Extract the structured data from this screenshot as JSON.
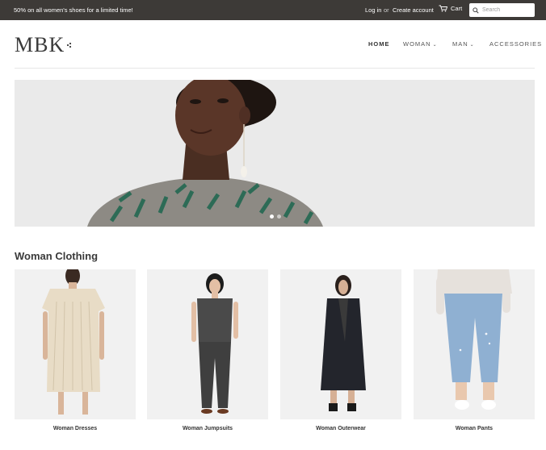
{
  "announcement": {
    "text": "50% on all women's shoes for a limited time!"
  },
  "account": {
    "login": "Log in",
    "or": "or",
    "create": "Create account"
  },
  "cart": {
    "label": "Cart"
  },
  "search": {
    "placeholder": "Search"
  },
  "brand": {
    "logo_text": "MBK"
  },
  "nav": {
    "home": "HOME",
    "woman": "WOMAN",
    "man": "MAN",
    "accessories": "ACCESSORIES"
  },
  "slideshow": {
    "slide_count": 2,
    "active_slide": 1
  },
  "section": {
    "title": "Woman Clothing"
  },
  "products": [
    {
      "label": "Woman Dresses"
    },
    {
      "label": "Woman Jumpsuits"
    },
    {
      "label": "Woman Outerwear"
    },
    {
      "label": "Woman Pants"
    }
  ],
  "colors": {
    "topbar_bg": "#3d3a37",
    "text": "#333333",
    "hero_bg": "#eaeaea"
  }
}
